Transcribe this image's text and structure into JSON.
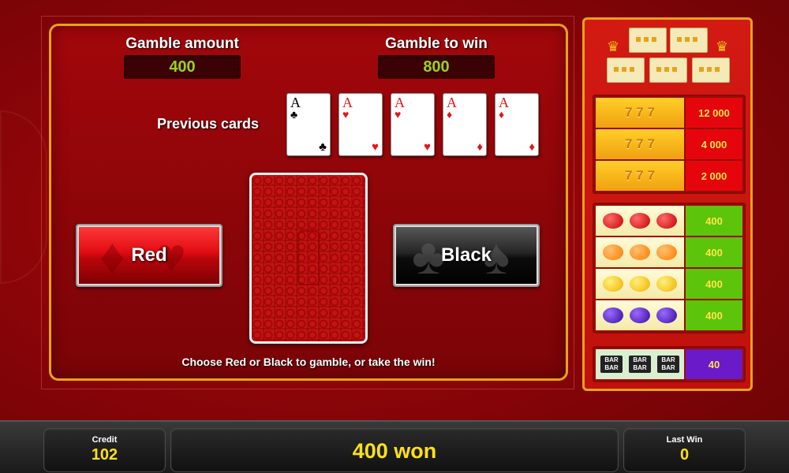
{
  "gamble": {
    "amount_label": "Gamble amount",
    "amount_value": "400",
    "to_win_label": "Gamble to win",
    "to_win_value": "800",
    "previous_cards_label": "Previous cards",
    "previous_cards": [
      {
        "rank": "A",
        "suit": "♣",
        "color": "black"
      },
      {
        "rank": "A",
        "suit": "♥",
        "color": "red"
      },
      {
        "rank": "A",
        "suit": "♥",
        "color": "red"
      },
      {
        "rank": "A",
        "suit": "♦",
        "color": "red"
      },
      {
        "rank": "A",
        "suit": "♦",
        "color": "red"
      }
    ],
    "red_button": "Red",
    "black_button": "Black",
    "instruction": "Choose Red or Black to gamble, or take the win!"
  },
  "paytable": {
    "sevens": [
      {
        "symbol": "777",
        "payout": "12 000"
      },
      {
        "symbol": "77",
        "payout": "4 000"
      },
      {
        "symbol": "7",
        "payout": "2 000"
      }
    ],
    "fruits": [
      {
        "symbol": "cherry",
        "payout": "400"
      },
      {
        "symbol": "orange",
        "payout": "400"
      },
      {
        "symbol": "lemon",
        "payout": "400"
      },
      {
        "symbol": "plum",
        "payout": "400"
      }
    ],
    "bar": {
      "symbol_text": "BAR",
      "payout": "40"
    }
  },
  "bottom": {
    "credit_label": "Credit",
    "credit_value": "102",
    "win_message": "400 won",
    "last_win_label": "Last Win",
    "last_win_value": "0"
  },
  "colors": {
    "accent_gold": "#e8a21a",
    "value_green": "#9ad21c",
    "value_yellow": "#ffe01a",
    "background_red": "#a2070b"
  }
}
